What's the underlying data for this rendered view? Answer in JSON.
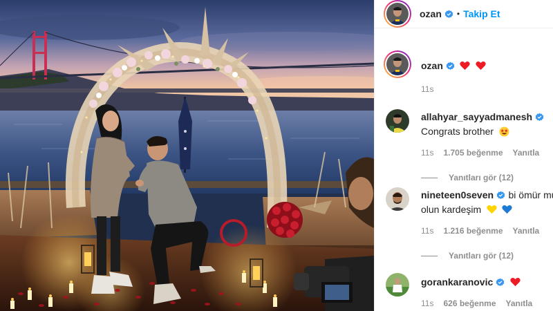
{
  "header": {
    "username": "ozan",
    "separator": "•",
    "follow_label": "Takip Et"
  },
  "caption": {
    "username": "ozan",
    "emojis": [
      "red-heart",
      "red-heart"
    ],
    "time": "11s"
  },
  "comments": [
    {
      "username": "allahyar_sayyadmanesh",
      "text": "Congrats brother",
      "emoji": "star-struck",
      "time": "11s",
      "likes": "1.705 beğenme",
      "reply_label": "Yanıtla",
      "view_replies": "Yanıtları gör (12)"
    },
    {
      "username": "nineteen0seven",
      "text": "bi ömür mu",
      "text_line2": "olun kardeşim",
      "emojis": [
        "yellow-heart",
        "blue-heart"
      ],
      "time": "11s",
      "likes": "1.216 beğenme",
      "reply_label": "Yanıtla",
      "view_replies": "Yanıtları gör (12)"
    },
    {
      "username": "gorankaranovic",
      "emoji": "red-heart",
      "time": "11s",
      "likes": "626 beğenme",
      "reply_label": "Yanıtla"
    }
  ],
  "colors": {
    "link_blue": "#0095f6",
    "verified_blue": "#3897f0",
    "meta_gray": "#8e8e8e",
    "text": "#262626",
    "heart_red": "#ed1c24"
  }
}
